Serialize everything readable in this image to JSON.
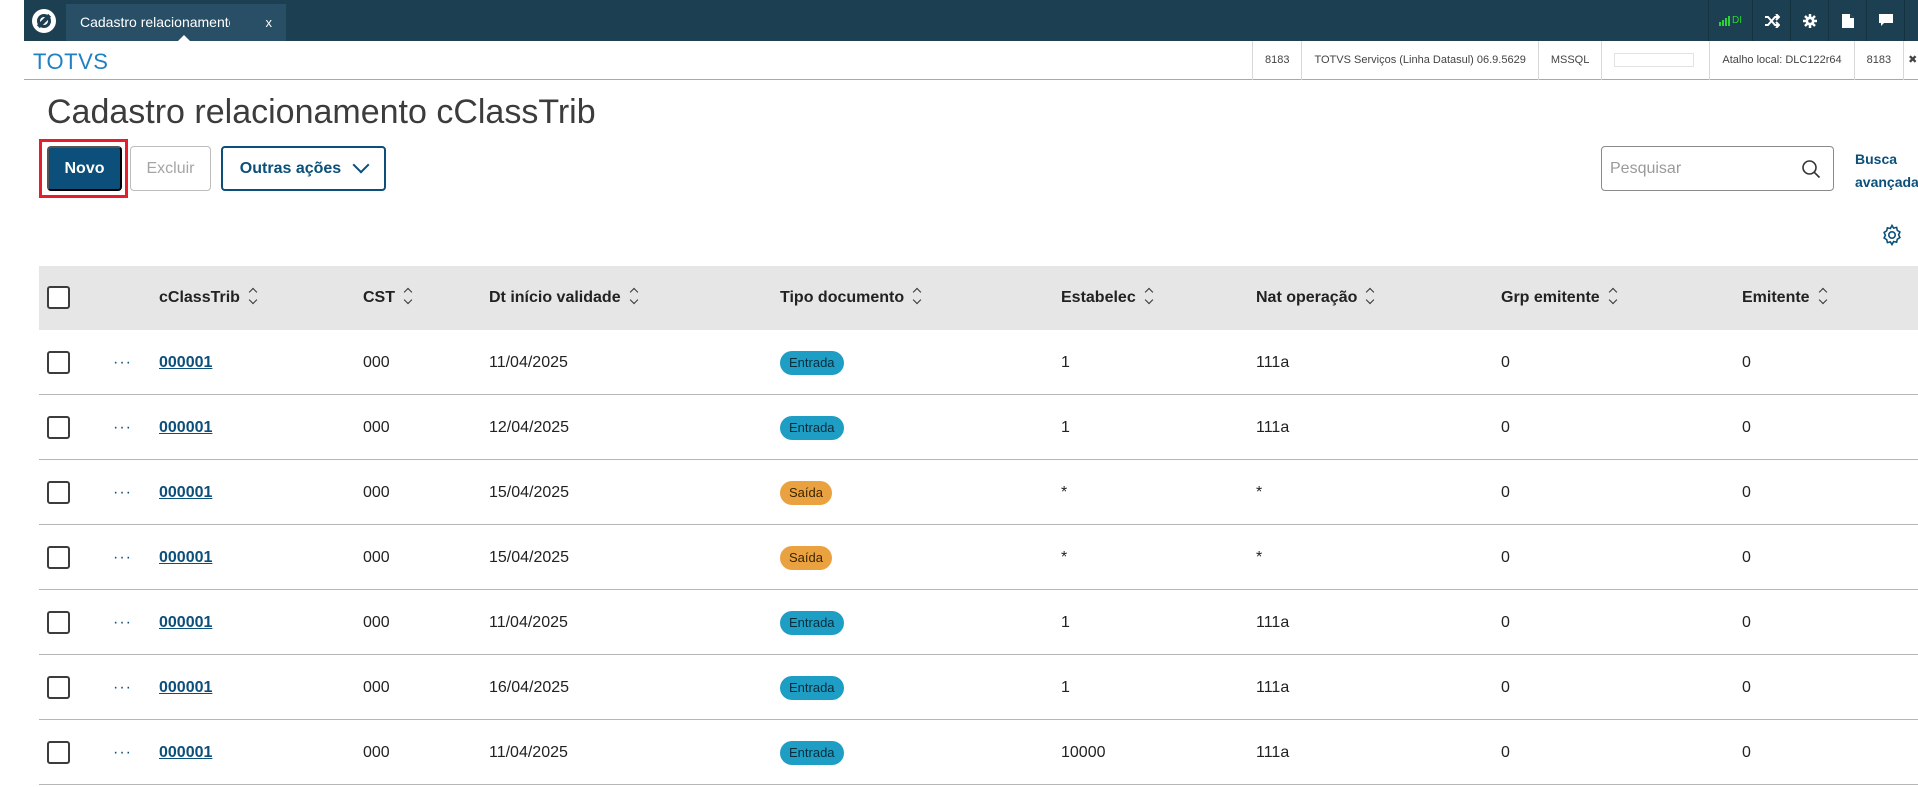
{
  "topbar": {
    "tab_label": "Cadastro relacionamento cClassTrib",
    "tab_close": "x",
    "signal_text": "DI"
  },
  "infobar": {
    "brand": "TOTVS",
    "cells": [
      "8183",
      "TOTVS Serviços (Linha Datasul) 06.9.5629",
      "MSSQL",
      "",
      "Atalho local: DLC122r64",
      "8183",
      "✖ S"
    ]
  },
  "page": {
    "title": "Cadastro relacionamento cClassTrib"
  },
  "actions": {
    "novo": "Novo",
    "excluir": "Excluir",
    "outras": "Outras ações"
  },
  "search": {
    "placeholder": "Pesquisar",
    "advanced_line1": "Busca",
    "advanced_line2": "avançada"
  },
  "table": {
    "columns": [
      "cClassTrib",
      "CST",
      "Dt início validade",
      "Tipo documento",
      "Estabelec",
      "Nat operação",
      "Grp emitente",
      "Emitente"
    ],
    "row_action": "···",
    "rows": [
      {
        "cclasstrib": "000001",
        "cst": "000",
        "dt": "11/04/2025",
        "tipo": "Entrada",
        "estab": "1",
        "nat": "111a",
        "grp": "0",
        "emit": "0"
      },
      {
        "cclasstrib": "000001",
        "cst": "000",
        "dt": "12/04/2025",
        "tipo": "Entrada",
        "estab": "1",
        "nat": "111a",
        "grp": "0",
        "emit": "0"
      },
      {
        "cclasstrib": "000001",
        "cst": "000",
        "dt": "15/04/2025",
        "tipo": "Saída",
        "estab": "*",
        "nat": "*",
        "grp": "0",
        "emit": "0"
      },
      {
        "cclasstrib": "000001",
        "cst": "000",
        "dt": "15/04/2025",
        "tipo": "Saída",
        "estab": "*",
        "nat": "*",
        "grp": "0",
        "emit": "0"
      },
      {
        "cclasstrib": "000001",
        "cst": "000",
        "dt": "11/04/2025",
        "tipo": "Entrada",
        "estab": "1",
        "nat": "111a",
        "grp": "0",
        "emit": "0"
      },
      {
        "cclasstrib": "000001",
        "cst": "000",
        "dt": "16/04/2025",
        "tipo": "Entrada",
        "estab": "1",
        "nat": "111a",
        "grp": "0",
        "emit": "0"
      },
      {
        "cclasstrib": "000001",
        "cst": "000",
        "dt": "11/04/2025",
        "tipo": "Entrada",
        "estab": "10000",
        "nat": "111a",
        "grp": "0",
        "emit": "0"
      }
    ]
  },
  "colors": {
    "topbar": "#1d3f52",
    "primary": "#0b4f7a",
    "brand": "#1f80c3",
    "entrada": "#1e9ec4",
    "saida": "#eaa13f",
    "highlight": "#e61e2b"
  },
  "icons": {
    "logo": "totvs-logo-icon",
    "signal": "signal-icon",
    "shuffle": "shuffle-icon",
    "settings": "gear-icon",
    "document": "document-icon",
    "chat": "chat-icon",
    "search": "search-icon",
    "column_settings": "gear-icon"
  }
}
